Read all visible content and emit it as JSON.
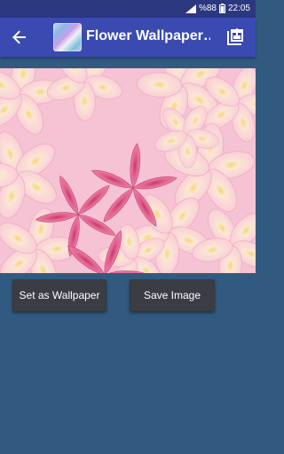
{
  "status_bar": {
    "battery": "%88",
    "time": "22:05"
  },
  "app_bar": {
    "title": "Flower Wallpaper…",
    "back_icon": "arrow-back-icon",
    "share_icon": "share-image-icon"
  },
  "preview": {
    "subject": "pink frangipani flowers"
  },
  "actions": {
    "set_wallpaper_label": "Set as Wallpaper",
    "save_image_label": "Save Image"
  },
  "colors": {
    "status_bar": "#2b3880",
    "app_bar": "#3a4ab0",
    "background": "#325a80",
    "button": "#3a3d43"
  }
}
